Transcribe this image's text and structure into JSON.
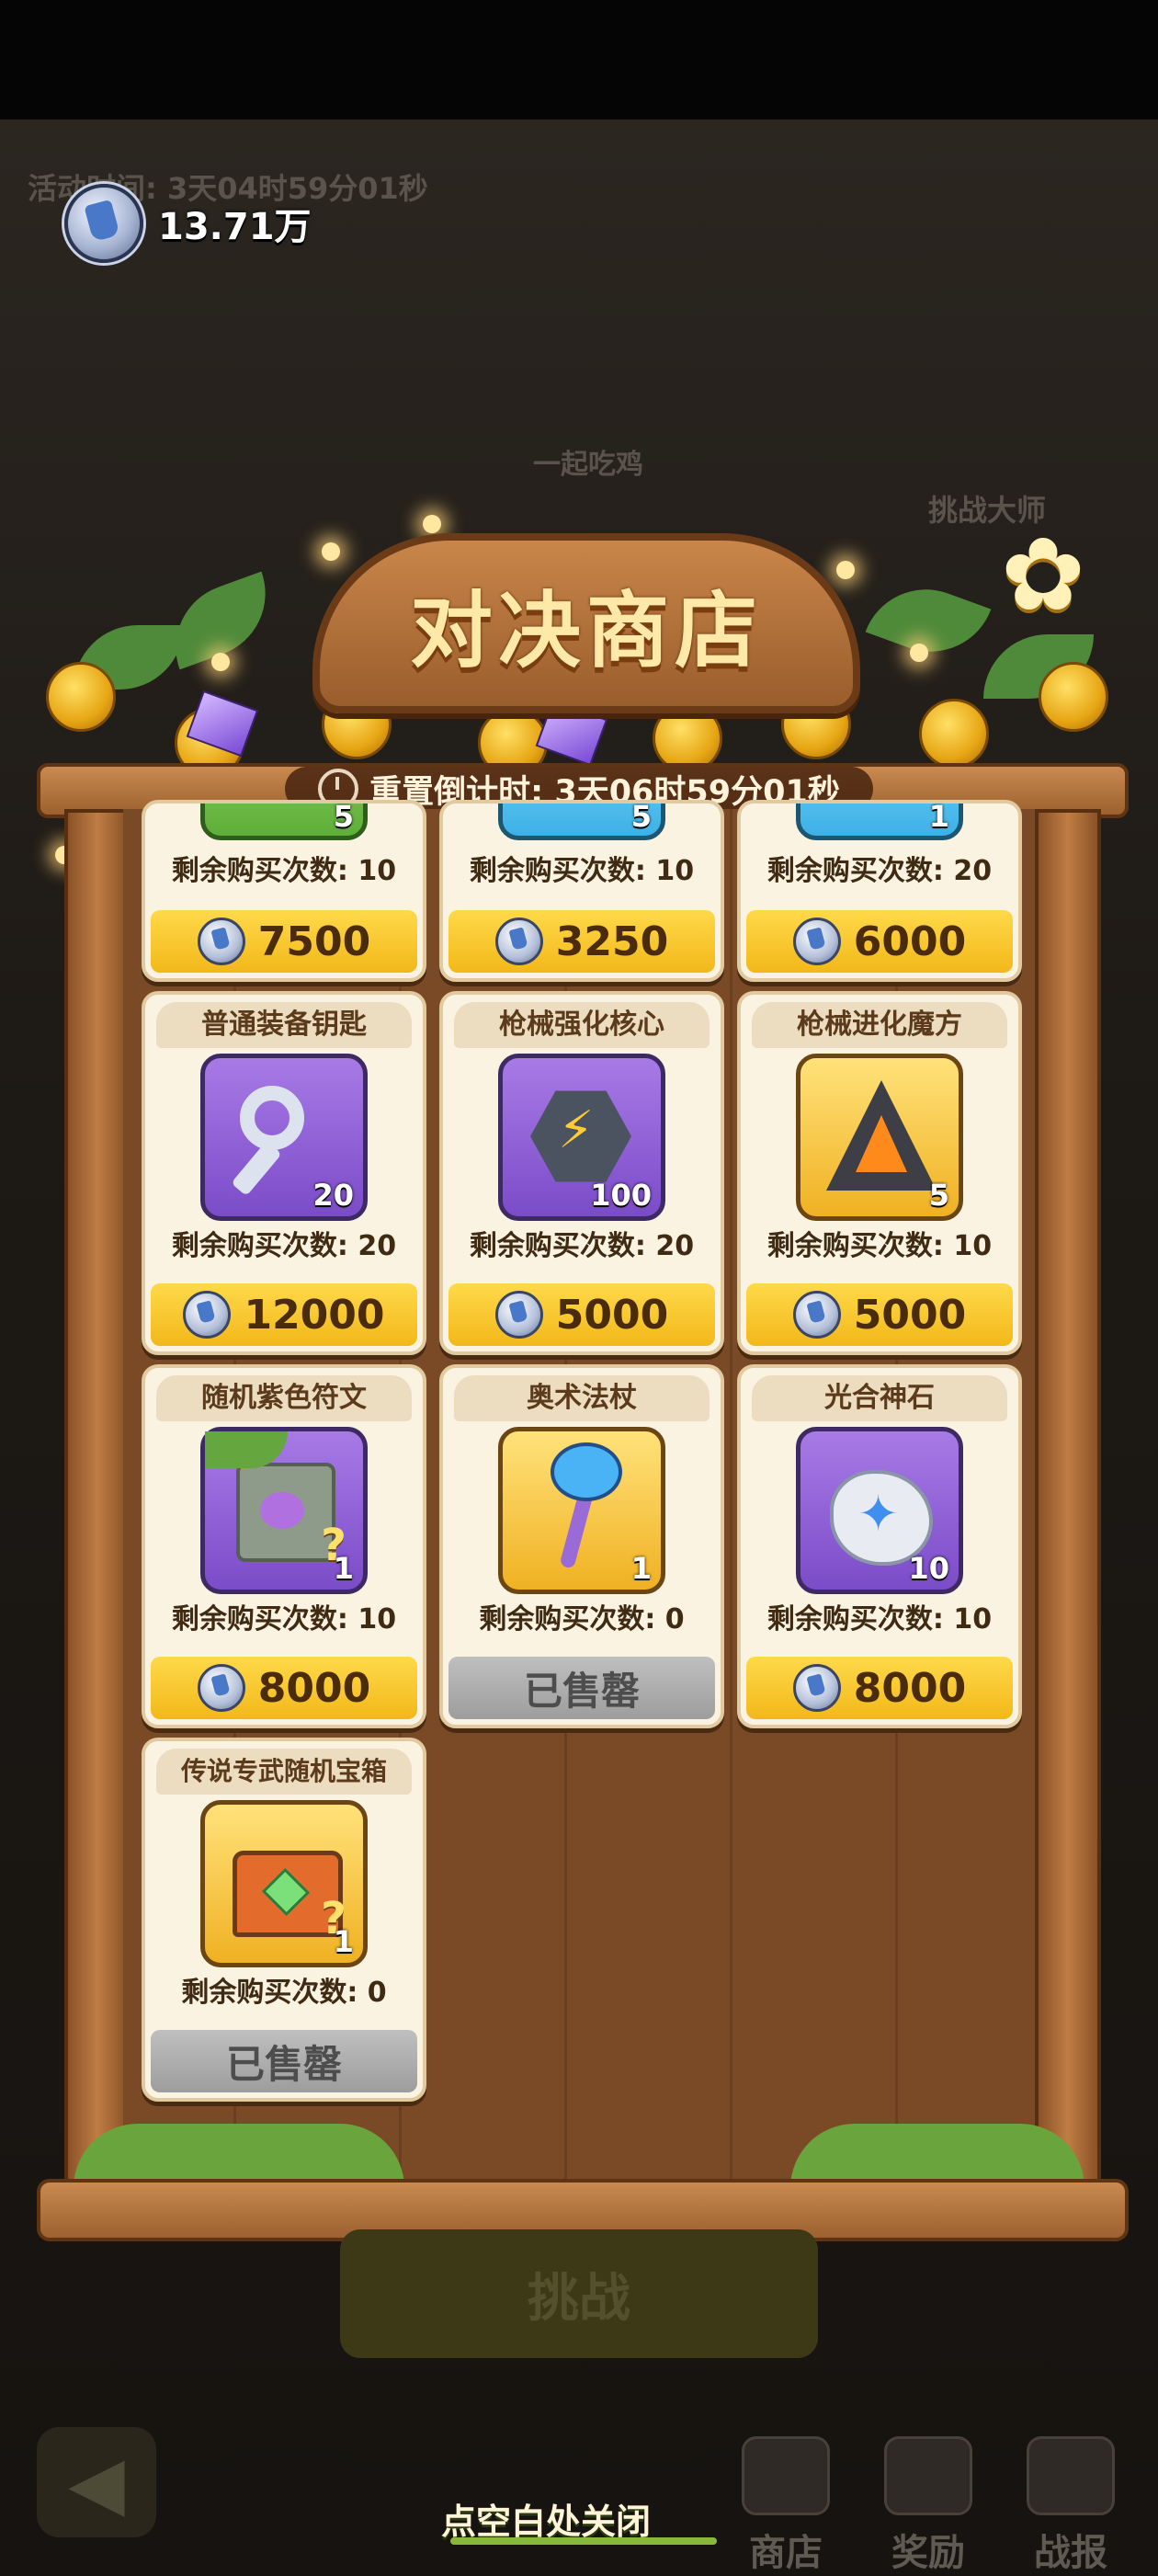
{
  "currency": {
    "amount": "13.71万",
    "icon": "silver-sword-coin-icon"
  },
  "shop": {
    "title": "对决商店",
    "reset_label": "重置倒计时: 3天06时59分01秒"
  },
  "items": [
    {
      "name": "",
      "qty": "5",
      "remain": "剩余购买次数: 10",
      "price": "7500",
      "sold": false,
      "icon": "green-leaf-icon"
    },
    {
      "name": "",
      "qty": "5",
      "remain": "剩余购买次数: 10",
      "price": "3250",
      "sold": false,
      "icon": "green-leaf-icon"
    },
    {
      "name": "",
      "qty": "1",
      "remain": "剩余购买次数: 20",
      "price": "6000",
      "sold": false,
      "icon": "gem-icon"
    },
    {
      "name": "普通装备钥匙",
      "qty": "20",
      "remain": "剩余购买次数: 20",
      "price": "12000",
      "sold": false,
      "icon": "key-icon"
    },
    {
      "name": "枪械强化核心",
      "qty": "100",
      "remain": "剩余购买次数: 20",
      "price": "5000",
      "sold": false,
      "icon": "hex-core-icon"
    },
    {
      "name": "枪械进化魔方",
      "qty": "5",
      "remain": "剩余购买次数: 10",
      "price": "5000",
      "sold": false,
      "icon": "prism-icon"
    },
    {
      "name": "随机紫色符文",
      "qty": "1",
      "remain": "剩余购买次数: 10",
      "price": "8000",
      "sold": false,
      "icon": "rune-cube-icon"
    },
    {
      "name": "奥术法杖",
      "qty": "1",
      "remain": "剩余购买次数: 0",
      "price": "已售罄",
      "sold": true,
      "icon": "staff-icon"
    },
    {
      "name": "光合神石",
      "qty": "10",
      "remain": "剩余购买次数: 10",
      "price": "8000",
      "sold": false,
      "icon": "stone-icon"
    },
    {
      "name": "传说专武随机宝箱",
      "qty": "1",
      "remain": "剩余购买次数: 0",
      "price": "已售罄",
      "sold": true,
      "icon": "chest-icon"
    }
  ],
  "background": {
    "activity_time": "活动时间: 3天04时59分01秒",
    "challenge": "挑战",
    "nav": [
      {
        "label": "商店"
      },
      {
        "label": "奖励"
      },
      {
        "label": "战报"
      }
    ],
    "side_tag": "挑战大师",
    "banner": "一起吃鸡"
  },
  "close_hint": "点空白处关闭",
  "colors": {
    "price_bar": "#f2b81a",
    "sold_bar": "#9d9d9d",
    "wood": "#9c6130"
  }
}
